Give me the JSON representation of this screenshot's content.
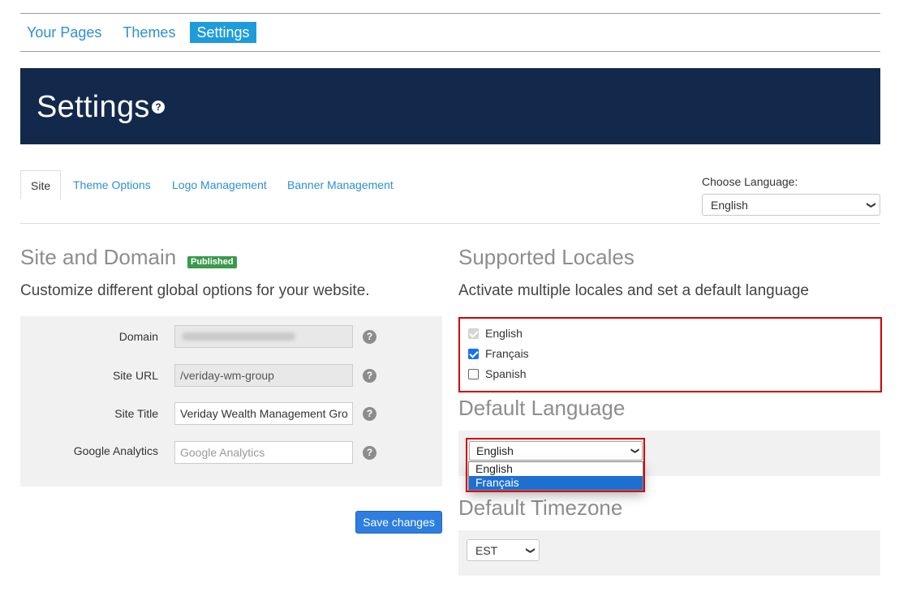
{
  "top_nav": {
    "items": [
      {
        "label": "Your Pages"
      },
      {
        "label": "Themes"
      },
      {
        "label": "Settings"
      }
    ]
  },
  "banner": {
    "title": "Settings",
    "help_icon": "question-circle-icon"
  },
  "sub_tabs": {
    "items": [
      {
        "label": "Site"
      },
      {
        "label": "Theme Options"
      },
      {
        "label": "Logo Management"
      },
      {
        "label": "Banner Management"
      }
    ],
    "active": "Site"
  },
  "choose_language": {
    "label": "Choose Language:",
    "value": "English"
  },
  "site_domain": {
    "title": "Site and Domain",
    "badge": "Published",
    "description": "Customize different global options for your website.",
    "fields": {
      "domain": {
        "label": "Domain",
        "value": ""
      },
      "site_url": {
        "label": "Site URL",
        "value": "/veriday-wm-group"
      },
      "site_title": {
        "label": "Site Title",
        "value": "Veriday Wealth Management Gro"
      },
      "google_analytics": {
        "label": "Google Analytics",
        "placeholder": "Google Analytics"
      }
    },
    "save_label": "Save changes"
  },
  "supported_locales": {
    "title": "Supported Locales",
    "description": "Activate multiple locales and set a default language",
    "locales": [
      {
        "label": "English",
        "checked": true,
        "disabled": true
      },
      {
        "label": "Français",
        "checked": true,
        "disabled": false
      },
      {
        "label": "Spanish",
        "checked": false,
        "disabled": false
      }
    ]
  },
  "default_language": {
    "title": "Default Language",
    "value": "English",
    "options": [
      "English",
      "Français"
    ],
    "highlighted": "Français"
  },
  "default_timezone": {
    "title": "Default Timezone",
    "value": "EST"
  },
  "colors": {
    "banner_bg": "#13294b",
    "accent": "#1e9bdb",
    "link": "#2d8fd3",
    "badge": "#3a9a4c",
    "highlight_border": "#d40000",
    "primary_button": "#2d7ee0"
  }
}
